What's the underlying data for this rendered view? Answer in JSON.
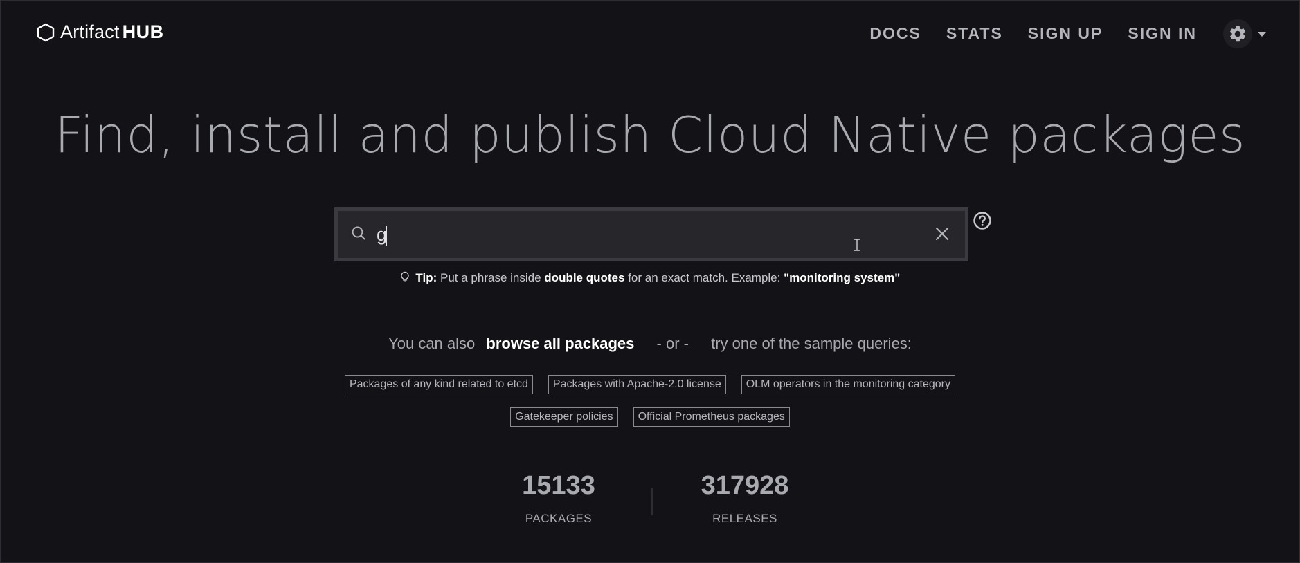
{
  "brand": {
    "logo_text": "Artifact",
    "logo_bold": "HUB"
  },
  "nav": {
    "links": [
      "DOCS",
      "STATS",
      "SIGN UP",
      "SIGN IN"
    ],
    "settings_icon": "gear-icon"
  },
  "hero": {
    "title": "Find, install and publish Cloud Native packages"
  },
  "search": {
    "value": "g",
    "placeholder": ""
  },
  "tip": {
    "label": "Tip:",
    "text1": "Put a phrase inside",
    "bold1": "double quotes",
    "text2": "for an exact match. Example:",
    "example": "\"monitoring system\""
  },
  "also": {
    "prefix": "You can also",
    "browse": "browse all packages",
    "or": "- or -",
    "suffix": "try one of the sample queries:"
  },
  "sample_queries": {
    "row1": [
      "Packages of any kind related to etcd",
      "Packages with Apache-2.0 license",
      "OLM operators in the monitoring category"
    ],
    "row2": [
      "Gatekeeper policies",
      "Official Prometheus packages"
    ]
  },
  "stats": {
    "packages": {
      "value": "15133",
      "label": "PACKAGES"
    },
    "releases": {
      "value": "317928",
      "label": "RELEASES"
    }
  },
  "colors": {
    "background": "#131317",
    "search_frame": "#3a3a40",
    "search_inner": "#26262b",
    "text_muted": "#a9a9b0",
    "text_bright": "#ffffff"
  }
}
